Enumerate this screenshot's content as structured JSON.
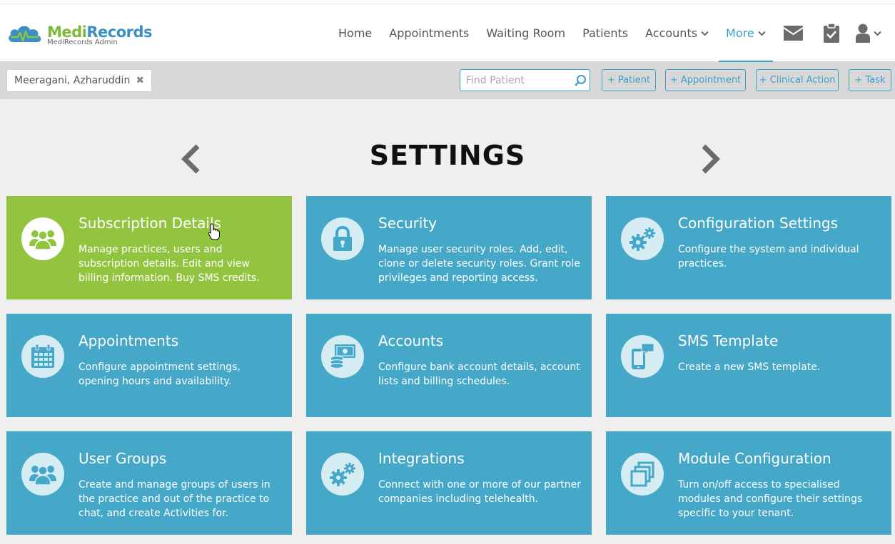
{
  "app": {
    "brand_part1": "Medi",
    "brand_part2": "Records",
    "subtitle": "MediRecords Admin"
  },
  "nav": {
    "items": [
      {
        "label": "Home"
      },
      {
        "label": "Appointments"
      },
      {
        "label": "Waiting Room"
      },
      {
        "label": "Patients"
      },
      {
        "label": "Accounts",
        "dropdown": true
      },
      {
        "label": "More",
        "dropdown": true,
        "active": true
      }
    ],
    "icons": [
      "mail-icon",
      "clipboard-check-icon",
      "user-icon"
    ]
  },
  "toolbar": {
    "patient_name": "Meeragani, Azharuddin",
    "search_placeholder": "Find Patient",
    "buttons": [
      "+ Patient",
      "+ Appointment",
      "+ Clinical Action",
      "+ Task"
    ]
  },
  "page": {
    "title": "SETTINGS"
  },
  "tiles": [
    {
      "title": "Subscription Details",
      "desc": "Manage practices, users and subscription details. Edit and view billing information. Buy SMS credits.",
      "icon": "users-group-icon",
      "color": "#93c43f"
    },
    {
      "title": "Security",
      "desc": "Manage user security roles. Add, edit, clone or delete security roles. Grant role privileges and reporting access.",
      "icon": "lock-icon",
      "color": "#45a8c8"
    },
    {
      "title": "Configuration Settings",
      "desc": "Configure the system and individual practices.",
      "icon": "gears-icon",
      "color": "#45a8c8"
    },
    {
      "title": "Appointments",
      "desc": "Configure appointment settings, opening hours and availability.",
      "icon": "calendar-icon",
      "color": "#45a8c8"
    },
    {
      "title": "Accounts",
      "desc": "Configure bank account details, account lists and billing schedules.",
      "icon": "money-icon",
      "color": "#45a8c8"
    },
    {
      "title": "SMS Template",
      "desc": "Create a new SMS template.",
      "icon": "mobile-message-icon",
      "color": "#45a8c8"
    },
    {
      "title": "User Groups",
      "desc": "Create and manage groups of users in the practice and out of the practice to chat, and create Activities for.",
      "icon": "users-group-icon",
      "color": "#45a8c8"
    },
    {
      "title": "Integrations",
      "desc": "Connect with one or more of our partner companies including telehealth.",
      "icon": "gears-icon",
      "color": "#45a8c8"
    },
    {
      "title": "Module Configuration",
      "desc": "Turn on/off access to specialised modules and configure their settings specific to your tenant.",
      "icon": "modules-icon",
      "color": "#45a8c8"
    }
  ]
}
